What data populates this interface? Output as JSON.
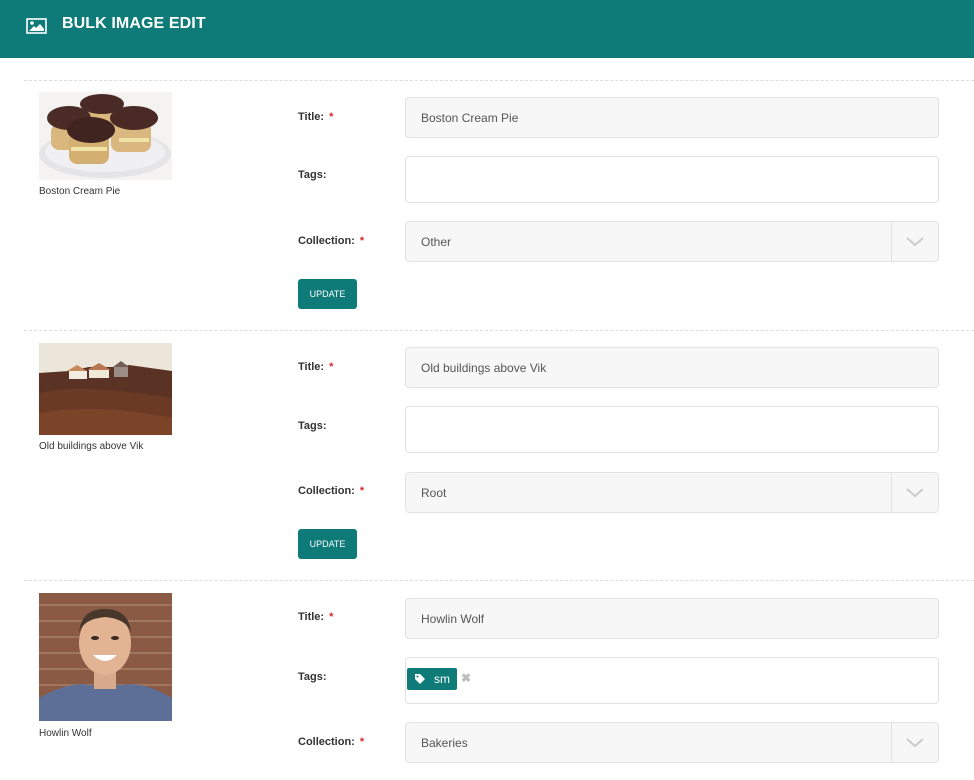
{
  "header": {
    "title": "BULK IMAGE EDIT",
    "icon": "image-icon"
  },
  "labels": {
    "title": "Title:",
    "tags": "Tags:",
    "collection": "Collection:",
    "required": "*",
    "update": "UPDATE"
  },
  "records": [
    {
      "caption": "Boston Cream Pie",
      "title": "Boston Cream Pie",
      "tags": [],
      "collection": "Other"
    },
    {
      "caption": "Old buildings above Vik",
      "title": "Old buildings above Vik",
      "tags": [],
      "collection": "Root"
    },
    {
      "caption": "Howlin Wolf",
      "title": "Howlin Wolf",
      "tags": [
        "sm"
      ],
      "collection": "Bakeries",
      "tag_remove": "✖"
    }
  ],
  "colors": {
    "brand": "#0e7b79",
    "required": "#d9262b"
  }
}
